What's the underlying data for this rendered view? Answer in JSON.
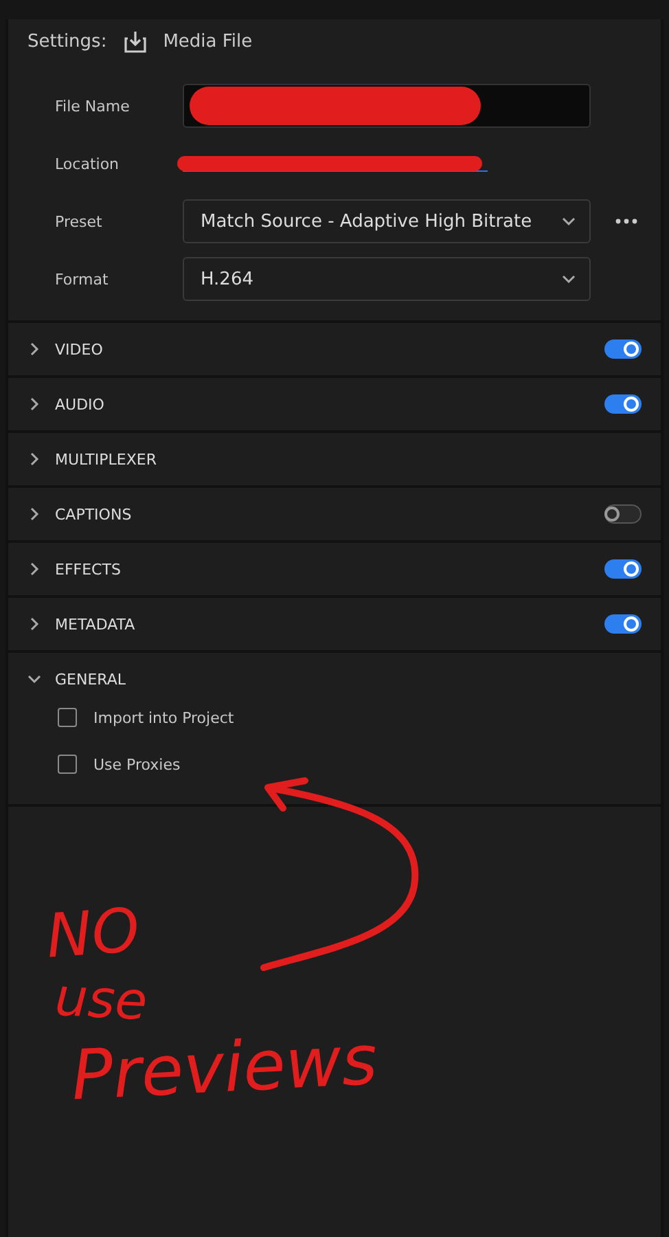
{
  "header": {
    "label": "Settings:",
    "title": "Media File"
  },
  "fields": [
    {
      "kind": "redacted-input",
      "label": "File Name"
    },
    {
      "kind": "redacted-link",
      "label": "Location"
    },
    {
      "kind": "select",
      "label": "Preset",
      "value": "Match Source - Adaptive High Bitrate",
      "more": true
    },
    {
      "kind": "select",
      "label": "Format",
      "value": "H.264"
    }
  ],
  "sections": [
    {
      "title": "VIDEO",
      "kind": "toggle",
      "on": true,
      "expanded": false
    },
    {
      "title": "AUDIO",
      "kind": "toggle",
      "on": true,
      "expanded": false
    },
    {
      "title": "MULTIPLEXER",
      "kind": "plain",
      "expanded": false
    },
    {
      "title": "CAPTIONS",
      "kind": "toggle",
      "on": false,
      "expanded": false
    },
    {
      "title": "EFFECTS",
      "kind": "toggle",
      "on": true,
      "expanded": false
    },
    {
      "title": "METADATA",
      "kind": "toggle",
      "on": true,
      "expanded": false
    },
    {
      "title": "GENERAL",
      "kind": "plain",
      "expanded": true,
      "children": [
        {
          "label": "Import into Project",
          "checked": false
        },
        {
          "label": "Use Proxies",
          "checked": false
        }
      ]
    }
  ],
  "annotation": {
    "lines": [
      "NO",
      "use",
      "Previews"
    ]
  }
}
